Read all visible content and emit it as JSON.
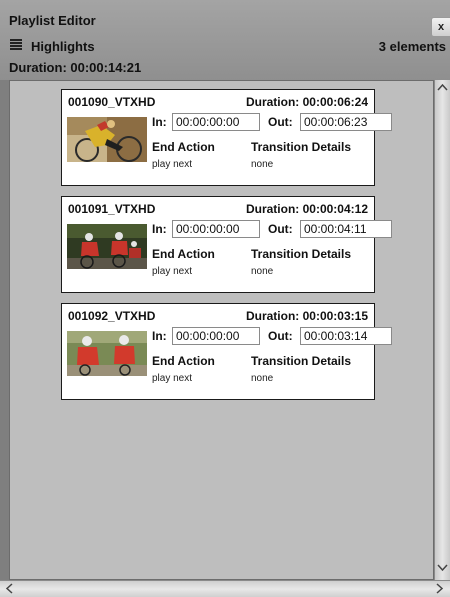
{
  "window": {
    "title": "Playlist Editor",
    "close_label": "x"
  },
  "playlist": {
    "name": "Highlights",
    "element_count": "3 elements",
    "duration": "Duration: 00:00:14:21"
  },
  "labels": {
    "in": "In:",
    "out": "Out:",
    "end_action": "End Action",
    "transition_details": "Transition Details"
  },
  "clips": [
    {
      "name": "001090_VTXHD",
      "duration": "Duration: 00:00:06:24",
      "in": "00:00:00:00",
      "out": "00:00:06:23",
      "end_action": "play next",
      "transition": "none"
    },
    {
      "name": "001091_VTXHD",
      "duration": "Duration: 00:00:04:12",
      "in": "00:00:00:00",
      "out": "00:00:04:11",
      "end_action": "play next",
      "transition": "none"
    },
    {
      "name": "001092_VTXHD",
      "duration": "Duration: 00:00:03:15",
      "in": "00:00:00:00",
      "out": "00:00:03:14",
      "end_action": "play next",
      "transition": "none"
    }
  ],
  "icons": {
    "list": "list-icon",
    "scroll_up": "chevron-up-icon",
    "scroll_down": "chevron-down-icon",
    "scroll_left": "chevron-left-icon",
    "scroll_right": "chevron-right-icon"
  }
}
